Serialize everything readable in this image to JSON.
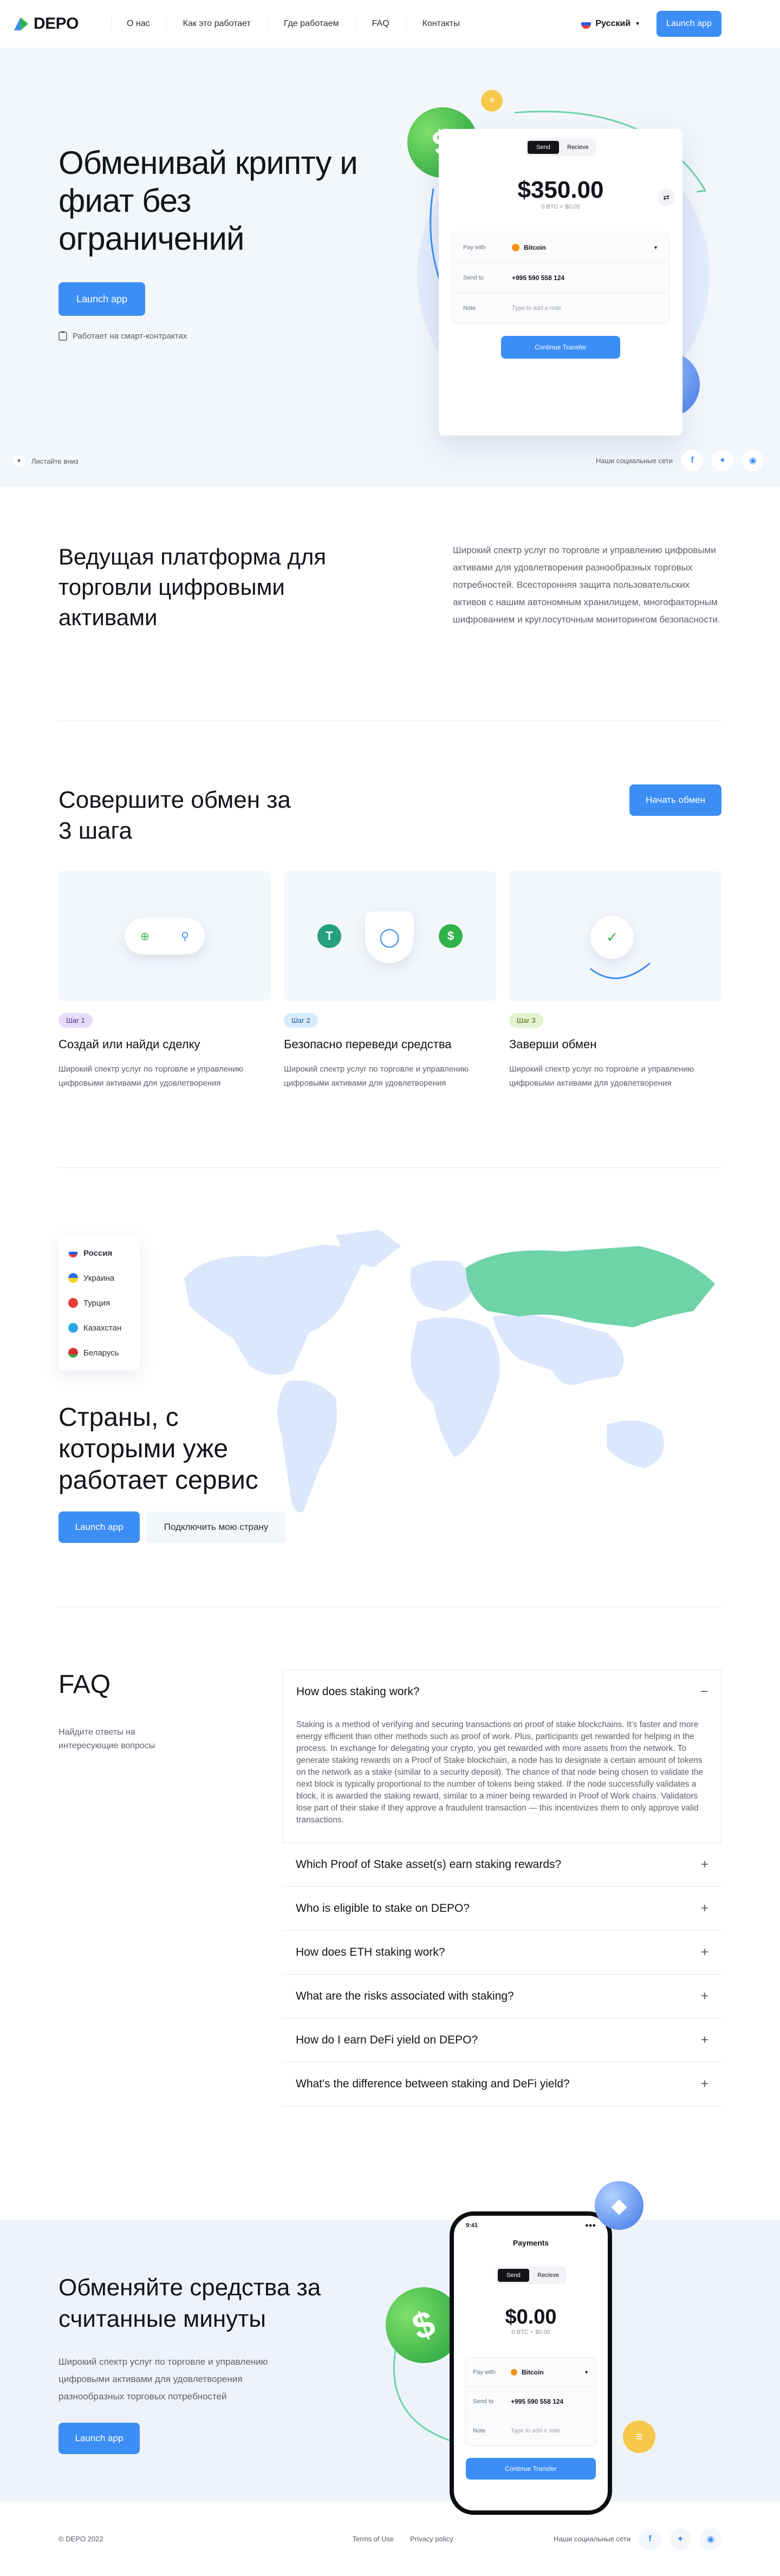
{
  "header": {
    "logo": "DEPO",
    "nav": [
      "О нас",
      "Как это работает",
      "Где работаем",
      "FAQ",
      "Контакты"
    ],
    "language": "Русский",
    "launch_label": "Launch app"
  },
  "hero": {
    "title": "Обменивай крипту и фиат без ограничений",
    "launch_label": "Launch app",
    "contract_note": "Работает на смарт-контрактах",
    "scroll_label": "Листайте вниз",
    "social_label": "Наши социальные сети",
    "card": {
      "tab_send": "Send",
      "tab_receive": "Recieve",
      "amount": "$350.00",
      "amount_sub": "0 BTC = $0.05",
      "pay_with_label": "Pay with",
      "pay_with_value": "Bitcoin",
      "send_to_label": "Send to",
      "send_to_value": "+995 590 558 124",
      "note_label": "Note",
      "note_placeholder": "Type to add a note",
      "continue_label": "Continue Transfer"
    }
  },
  "about": {
    "title": "Ведущая платформа для торговли цифровыми активами",
    "text": "Широкий спектр услуг по торговле и управлению цифровыми активами для удовлетворения разнообразных торговых потребностей. Всесторонняя защита пользовательских активов с нашим автономным хранилищем, многофакторным шифрованием и круглосуточным мониторингом безопасности."
  },
  "steps": {
    "title": "Совершите обмен за 3 шага",
    "button": "Начать обмен",
    "items": [
      {
        "tag": "Шаг 1",
        "title": "Создай или найди сделку",
        "text": "Широкий спектр услуг по торговле и управлению цифровыми активами для удовлетворения"
      },
      {
        "tag": "Шаг 2",
        "title": "Безопасно переведи средства",
        "text": "Широкий спектр услуг по торговле и управлению цифровыми активами для удовлетворения"
      },
      {
        "tag": "Шаг 3",
        "title": "Заверши обмен",
        "text": "Широкий спектр услуг по торговле и управлению цифровыми активами для удовлетворения"
      }
    ]
  },
  "countries": {
    "list": [
      "Россия",
      "Украина",
      "Турция",
      "Казахстан",
      "Беларусь"
    ],
    "title": "Страны, с которыми уже работает сервис",
    "launch_label": "Launch app",
    "connect_label": "Подключить мою страну"
  },
  "faq": {
    "title": "FAQ",
    "lead": "Найдите ответы на интересующие вопросы",
    "items": [
      {
        "q": "How does staking work?",
        "a": "Staking is a method of verifying and securing transactions on proof of stake blockchains. It's faster and more energy efficient than other methods such as proof of work. Plus, participants get rewarded for helping in the process. In exchange for delegating your crypto, you get rewarded with more assets from the network. To generate staking rewards on a Proof of Stake blockchain, a node has to designate a certain amount of tokens on the network as a stake (similar to a security deposit). The chance of that node being chosen to validate the next block is typically proportional to the number of tokens being staked. If the node successfully validates a block, it is awarded the staking reward, similar to a miner being rewarded in Proof of Work chains. Validators lose part of their stake if they approve a fraudulent transaction — this incentivizes them to only approve valid transactions."
      },
      {
        "q": "Which Proof of Stake asset(s) earn staking rewards?"
      },
      {
        "q": "Who is eligible to stake on DEPO?"
      },
      {
        "q": "How does ETH staking work?"
      },
      {
        "q": "What are the risks associated with staking?"
      },
      {
        "q": "How do I earn DeFi yield on DEPO?"
      },
      {
        "q": "What's the difference between staking and DeFi yield?"
      }
    ]
  },
  "cta": {
    "title": "Обменяйте средства за считанные минуты",
    "text": "Широкий спектр услуг по торговле и управлению цифровыми активами для удовлетворения разнообразных торговых потребностей",
    "launch_label": "Launch app",
    "phone": {
      "time": "9:41",
      "title": "Payments",
      "tab_send": "Send",
      "tab_receive": "Recieve",
      "amount": "$0.00",
      "amount_sub": "0 BTC = $0.00",
      "pay_with_label": "Pay with",
      "pay_with_value": "Bitcoin",
      "send_to_label": "Send to",
      "send_to_value": "+995 590 558 124",
      "note_label": "Note",
      "note_placeholder": "Type to add a note",
      "continue_label": "Continue Transfer"
    }
  },
  "footer": {
    "copyright": "© DEPO 2022",
    "terms": "Terms of Use",
    "privacy": "Privacy policy",
    "social_label": "Наши социальные сети"
  },
  "colors": {
    "accent": "#3c8ef5",
    "green": "#2fb34a",
    "russia": "#6fd3a8",
    "map": "#dbe7fb"
  }
}
